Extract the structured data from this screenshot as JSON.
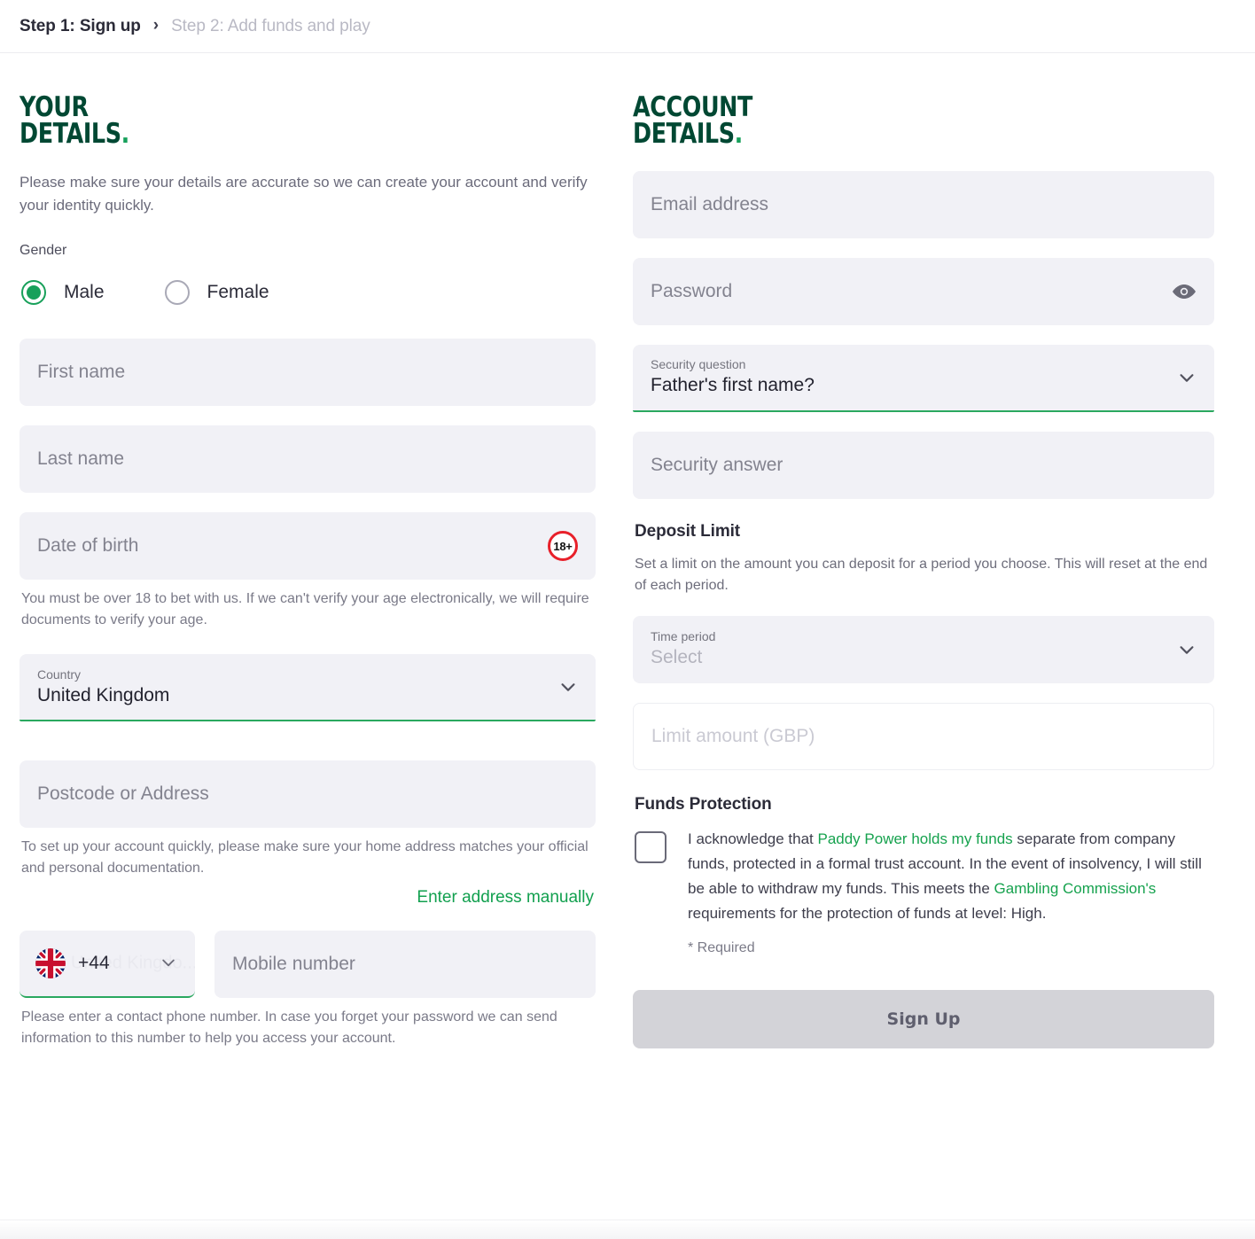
{
  "breadcrumb": {
    "step1": "Step 1: Sign up",
    "separator": "›",
    "step2": "Step 2: Add funds and play"
  },
  "colors": {
    "brand_dark_green": "#004833",
    "brand_green": "#12a04f",
    "accent_green": "#18a05a",
    "field_bg": "#f1f1f6",
    "disabled_btn": "#d3d3d8",
    "age_badge_red": "#e8202a"
  },
  "your_details": {
    "heading_line1": "YOUR",
    "heading_line2": "DETAILS",
    "heading_dot": ".",
    "intro": "Please make sure your details are accurate so we can create your account and verify your identity quickly.",
    "gender_label": "Gender",
    "gender_options": [
      {
        "label": "Male",
        "selected": true
      },
      {
        "label": "Female",
        "selected": false
      }
    ],
    "first_name_placeholder": "First name",
    "first_name_value": "",
    "last_name_placeholder": "Last name",
    "last_name_value": "",
    "dob_placeholder": "Date of birth",
    "dob_value": "",
    "age_badge": "18+",
    "dob_helper": "You must be over 18 to bet with us. If we can't verify your age electronically, we will require documents to verify your age.",
    "country_label": "Country",
    "country_value": "United Kingdom",
    "postcode_placeholder": "Postcode or Address",
    "postcode_value": "",
    "address_helper": "To set up your account quickly, please make sure your home address matches your official and personal documentation.",
    "manual_address_link": "Enter address manually",
    "dial_code": "+44",
    "dial_ghost": "United Kingdo...",
    "flag_name": "uk-flag",
    "mobile_placeholder": "Mobile number",
    "mobile_value": "",
    "phone_helper": "Please enter a contact phone number. In case you forget your password we can send information to this number to help you access your account."
  },
  "account_details": {
    "heading_line1": "ACCOUNT",
    "heading_line2": "DETAILS",
    "heading_dot": ".",
    "email_placeholder": "Email address",
    "email_value": "",
    "password_placeholder": "Password",
    "password_value": "",
    "security_question_label": "Security question",
    "security_question_value": "Father's first name?",
    "security_answer_placeholder": "Security answer",
    "security_answer_value": "",
    "deposit_limit": {
      "title": "Deposit Limit",
      "description": "Set a limit on the amount you can deposit for a period you choose. This will reset at the end of each period.",
      "time_period_label": "Time period",
      "time_period_value": "Select",
      "limit_amount_placeholder": "Limit amount (GBP)",
      "limit_amount_value": ""
    },
    "funds_protection": {
      "title": "Funds Protection",
      "checked": false,
      "text_1": "I acknowledge that ",
      "link_1": "Paddy Power holds my funds",
      "text_2": " separate from company funds, protected in a formal trust account. In the event of insolvency, I will still be able to withdraw my funds. This meets the ",
      "link_2": "Gambling Commission's",
      "text_3": " requirements for the protection of funds at level: High.",
      "required_note": "* Required"
    },
    "signup_button": "Sign Up",
    "signup_enabled": false
  }
}
